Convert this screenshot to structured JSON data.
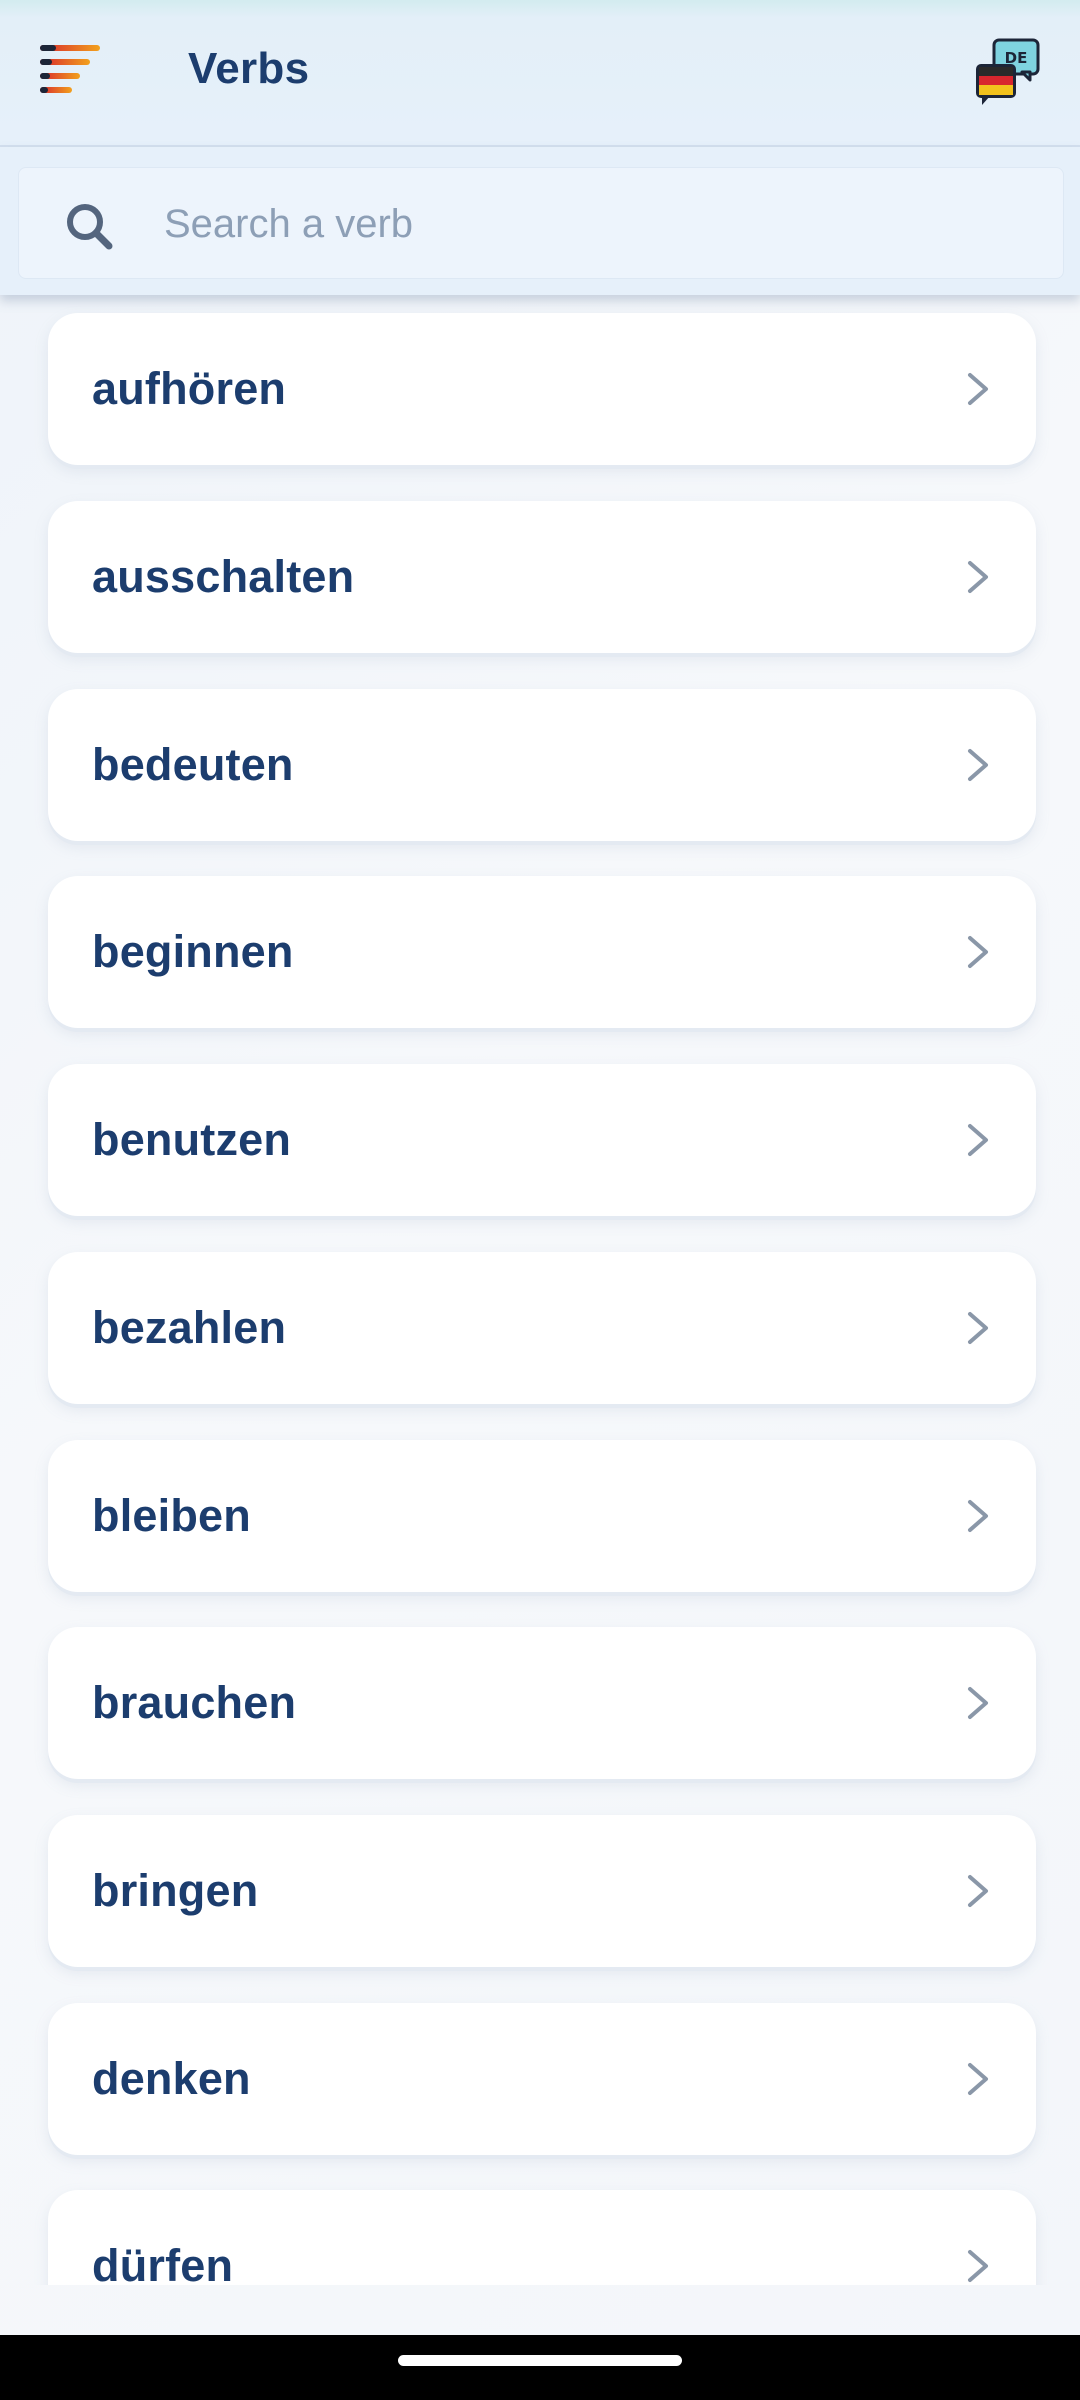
{
  "header": {
    "title": "Verbs",
    "menu_icon": "hamburger-menu-icon",
    "language_icon": "german-language-chat-icon",
    "language_code": "DE"
  },
  "search": {
    "placeholder": "Search a verb",
    "value": "",
    "icon": "search-icon"
  },
  "verbs": [
    {
      "label": "aufhören"
    },
    {
      "label": "ausschalten"
    },
    {
      "label": "bedeuten"
    },
    {
      "label": "beginnen"
    },
    {
      "label": "benutzen"
    },
    {
      "label": "bezahlen"
    },
    {
      "label": "bleiben"
    },
    {
      "label": "brauchen"
    },
    {
      "label": "bringen"
    },
    {
      "label": "denken"
    },
    {
      "label": "dürfen"
    }
  ],
  "colors": {
    "accent_text": "#1c3d6e",
    "header_bg": "#e6f0fa",
    "menu_red": "#d8262e",
    "menu_orange": "#f2a11d",
    "chevron": "#8a97a8"
  }
}
